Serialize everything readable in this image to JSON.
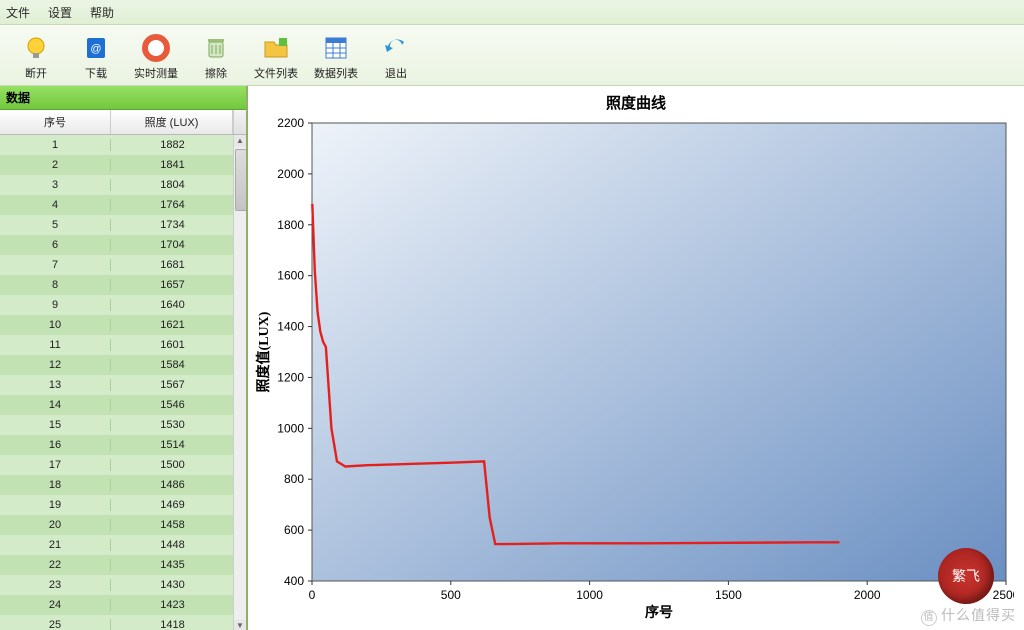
{
  "menu": {
    "file": "文件",
    "settings": "设置",
    "help": "帮助"
  },
  "toolbar": {
    "disconnect": "断开",
    "download": "下载",
    "realtime": "实时测量",
    "clear": "擦除",
    "filelist": "文件列表",
    "datalist": "数据列表",
    "exit": "退出"
  },
  "panel": {
    "header": "数据"
  },
  "table": {
    "columns": {
      "seq": "序号",
      "lux": "照度 (LUX)"
    },
    "rows": [
      {
        "seq": "1",
        "lux": "1882"
      },
      {
        "seq": "2",
        "lux": "1841"
      },
      {
        "seq": "3",
        "lux": "1804"
      },
      {
        "seq": "4",
        "lux": "1764"
      },
      {
        "seq": "5",
        "lux": "1734"
      },
      {
        "seq": "6",
        "lux": "1704"
      },
      {
        "seq": "7",
        "lux": "1681"
      },
      {
        "seq": "8",
        "lux": "1657"
      },
      {
        "seq": "9",
        "lux": "1640"
      },
      {
        "seq": "10",
        "lux": "1621"
      },
      {
        "seq": "11",
        "lux": "1601"
      },
      {
        "seq": "12",
        "lux": "1584"
      },
      {
        "seq": "13",
        "lux": "1567"
      },
      {
        "seq": "14",
        "lux": "1546"
      },
      {
        "seq": "15",
        "lux": "1530"
      },
      {
        "seq": "16",
        "lux": "1514"
      },
      {
        "seq": "17",
        "lux": "1500"
      },
      {
        "seq": "18",
        "lux": "1486"
      },
      {
        "seq": "19",
        "lux": "1469"
      },
      {
        "seq": "20",
        "lux": "1458"
      },
      {
        "seq": "21",
        "lux": "1448"
      },
      {
        "seq": "22",
        "lux": "1435"
      },
      {
        "seq": "23",
        "lux": "1430"
      },
      {
        "seq": "24",
        "lux": "1423"
      },
      {
        "seq": "25",
        "lux": "1418"
      }
    ]
  },
  "chart_data": {
    "type": "line",
    "title": "照度曲线",
    "xlabel": "序号",
    "ylabel": "照度值(LUX)",
    "xlim": [
      0,
      2500
    ],
    "ylim": [
      400,
      2200
    ],
    "xticks": [
      0,
      500,
      1000,
      1500,
      2000,
      2500
    ],
    "yticks": [
      400,
      600,
      800,
      1000,
      1200,
      1400,
      1600,
      1800,
      2000,
      2200
    ],
    "series": [
      {
        "name": "lux",
        "color": "#e4201e",
        "points": [
          [
            1,
            1882
          ],
          [
            10,
            1621
          ],
          [
            20,
            1458
          ],
          [
            30,
            1380
          ],
          [
            40,
            1340
          ],
          [
            50,
            1320
          ],
          [
            70,
            1000
          ],
          [
            90,
            870
          ],
          [
            120,
            850
          ],
          [
            200,
            855
          ],
          [
            350,
            860
          ],
          [
            500,
            865
          ],
          [
            620,
            870
          ],
          [
            640,
            650
          ],
          [
            660,
            545
          ],
          [
            700,
            545
          ],
          [
            900,
            548
          ],
          [
            1200,
            548
          ],
          [
            1500,
            550
          ],
          [
            1800,
            552
          ],
          [
            1900,
            552
          ]
        ]
      }
    ]
  },
  "watermark": {
    "text": "什么值得买",
    "seal": "繁飞"
  }
}
